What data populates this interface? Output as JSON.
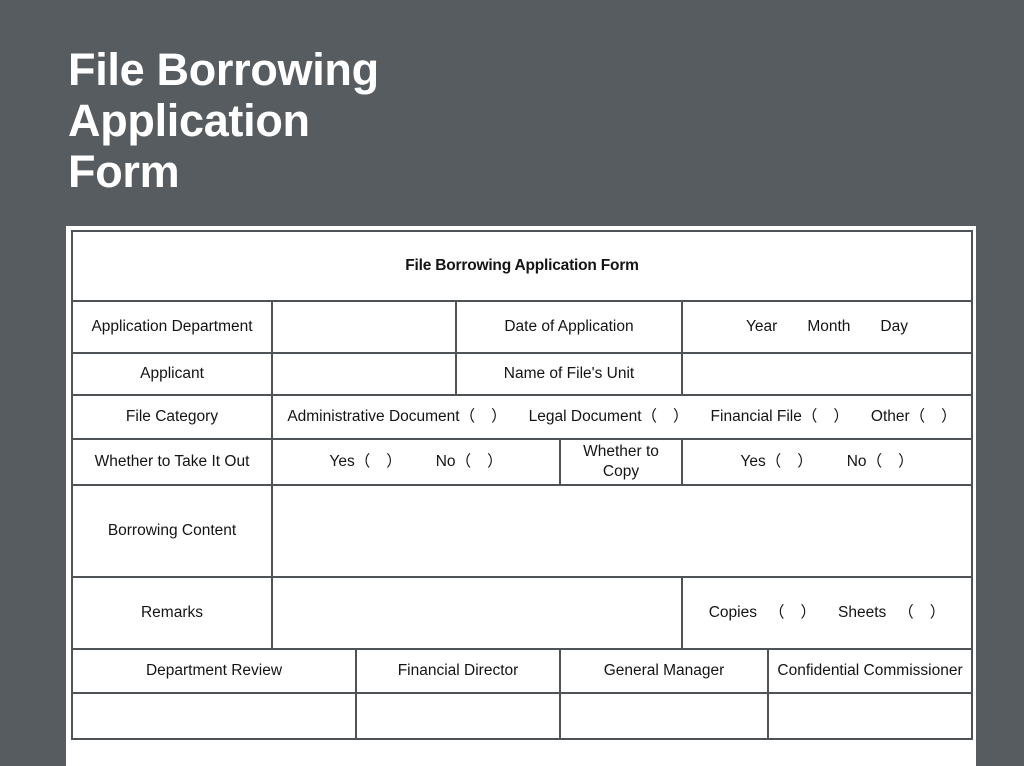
{
  "slide": {
    "title": "File Borrowing\nApplication\nForm",
    "background_color": "#565c60",
    "title_color": "#ffffff"
  },
  "form": {
    "heading": "File Borrowing Application Form",
    "border_color": "#4f5355",
    "text_color": "#141414",
    "rows": {
      "application_department": {
        "label": "Application Department",
        "value": "",
        "date_label": "Date of Application",
        "date_year": "Year",
        "date_month": "Month",
        "date_day": "Day"
      },
      "applicant": {
        "label": "Applicant",
        "value": "",
        "unit_label": "Name of File's Unit",
        "unit_value": ""
      },
      "file_category": {
        "label": "File Category",
        "options": [
          {
            "name": "Administrative Document",
            "open": "（",
            "close": "）"
          },
          {
            "name": "Legal Document",
            "open": "（",
            "close": "）"
          },
          {
            "name": "Financial File",
            "open": "（",
            "close": "）"
          },
          {
            "name": "Other",
            "open": "（",
            "close": "）"
          }
        ],
        "text_line1": "Administrative Document（　）Legal Document（　）Financial File（　）Other（",
        "text_line2": "）"
      },
      "take_it_out": {
        "label": "Whether to Take It Out",
        "yes": "Yes",
        "no": "No",
        "open": "（",
        "close": "）"
      },
      "copy": {
        "label": "Whether to Copy",
        "yes": "Yes",
        "no": "No",
        "open": "（",
        "close": "）"
      },
      "borrowing_content": {
        "label": "Borrowing Content",
        "value": ""
      },
      "remarks": {
        "label": "Remarks",
        "value": "",
        "copies_label": "Copies",
        "sheets_label": "Sheets",
        "open": "（",
        "close": "）"
      },
      "signatures": {
        "department_review": "Department Review",
        "financial_director": "Financial Director",
        "general_manager": "General Manager",
        "confidential_commissioner": "Confidential Commissioner",
        "department_review_value": "",
        "financial_director_value": "",
        "general_manager_value": "",
        "confidential_commissioner_value": ""
      }
    }
  }
}
